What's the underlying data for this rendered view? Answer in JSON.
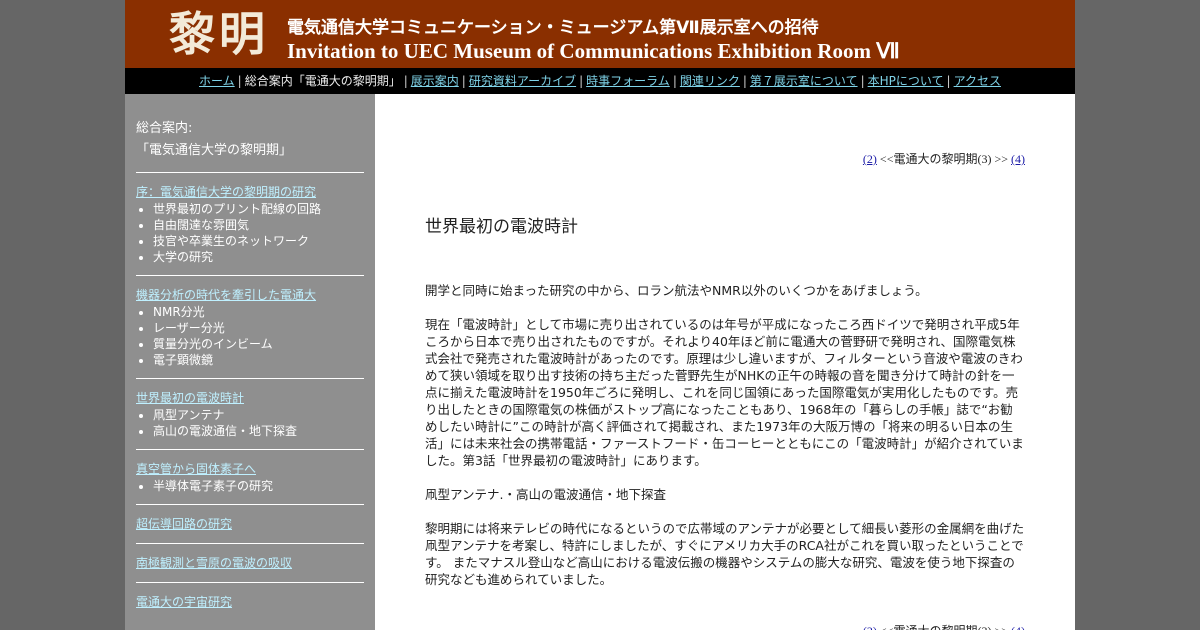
{
  "banner": {
    "logo": "黎明",
    "title_jp": "電気通信大学コミュニケーション・ミュージアム第Ⅶ展示室への招待",
    "title_en": "Invitation to UEC Museum of Communications Exhibition Room Ⅶ",
    "bg_color": "#8a2f00"
  },
  "nav": {
    "home": "ホーム",
    "current": "総合案内「電通大の黎明期」",
    "items": [
      "展示案内",
      "研究資料アーカイブ",
      "時事フォーラム",
      "関連リンク",
      "第７展示室について",
      "本HPについて",
      "アクセス"
    ],
    "link_color": "#7fd3e8"
  },
  "sidebar": {
    "heading": "総合案内:",
    "subheading": "「電気通信大学の黎明期」",
    "sections": [
      {
        "title": "序：電気通信大学の黎明期の研究",
        "items": [
          "世界最初のプリント配線の回路",
          "自由闊達な雰囲気",
          "技官や卒業生のネットワーク",
          "大学の研究"
        ]
      },
      {
        "title": "機器分析の時代を牽引した電通大",
        "items": [
          "NMR分光",
          "レーザー分光",
          "質量分光のインビーム",
          "電子顕微鏡"
        ]
      },
      {
        "title": "世界最初の電波時計",
        "items": [
          "凧型アンテナ",
          "高山の電波通信・地下探査"
        ]
      },
      {
        "title": "真空管から固体素子へ",
        "items": [
          "半導体電子素子の研究"
        ]
      },
      {
        "title": "超伝導回路の研究",
        "items": []
      },
      {
        "title": "南極観測と雪原の電波の吸収",
        "items": []
      },
      {
        "title": "電通大の宇宙研究",
        "items": []
      }
    ]
  },
  "pager": {
    "prev": "(2)",
    "label": "<<電通大の黎明期(3) >>",
    "next": "(4)"
  },
  "article": {
    "title": "世界最初の電波時計",
    "paragraphs": [
      "開学と同時に始まった研究の中から、ロラン航法やNMR以外のいくつかをあげましょう。",
      "現在「電波時計」として市場に売り出されているのは年号が平成になったころ西ドイツで発明され平成5年ころから日本で売り出されたものですが。それより40年ほど前に電通大の菅野研で発明され、国際電気株式会社で発売された電波時計があったのです。原理は少し違いますが、フィルターという音波や電波のきわめて狭い領域を取り出す技術の持ち主だった菅野先生がNHKの正午の時報の音を聞き分けて時計の針を一点に揃えた電波時計を1950年ごろに発明し、これを同じ国領にあった国際電気が実用化したものです。売り出したときの国際電気の株価がストップ高になったこともあり、1968年の「暮らしの手帳」誌で“お勧めしたい時計に”この時計が高く評価されて掲載され、また1973年の大阪万博の「将来の明るい日本の生活」には未来社会の携帯電話・ファーストフード・缶コーヒーとともにこの「電波時計」が紹介されていました。第3話「世界最初の電波時計」にあります。",
      "凧型アンテナ.・高山の電波通信・地下探査",
      "黎明期には将来テレビの時代になるというので広帯域のアンテナが必要として細長い菱形の金属網を曲げた凧型アンテナを考案し、特許にしましたが、すぐにアメリカ大手のRCA社がこれを買い取ったということです。 またマナスル登山など高山における電波伝搬の機器やシステムの膨大な研究、電波を使う地下探査の研究なども進められていました。"
    ]
  }
}
